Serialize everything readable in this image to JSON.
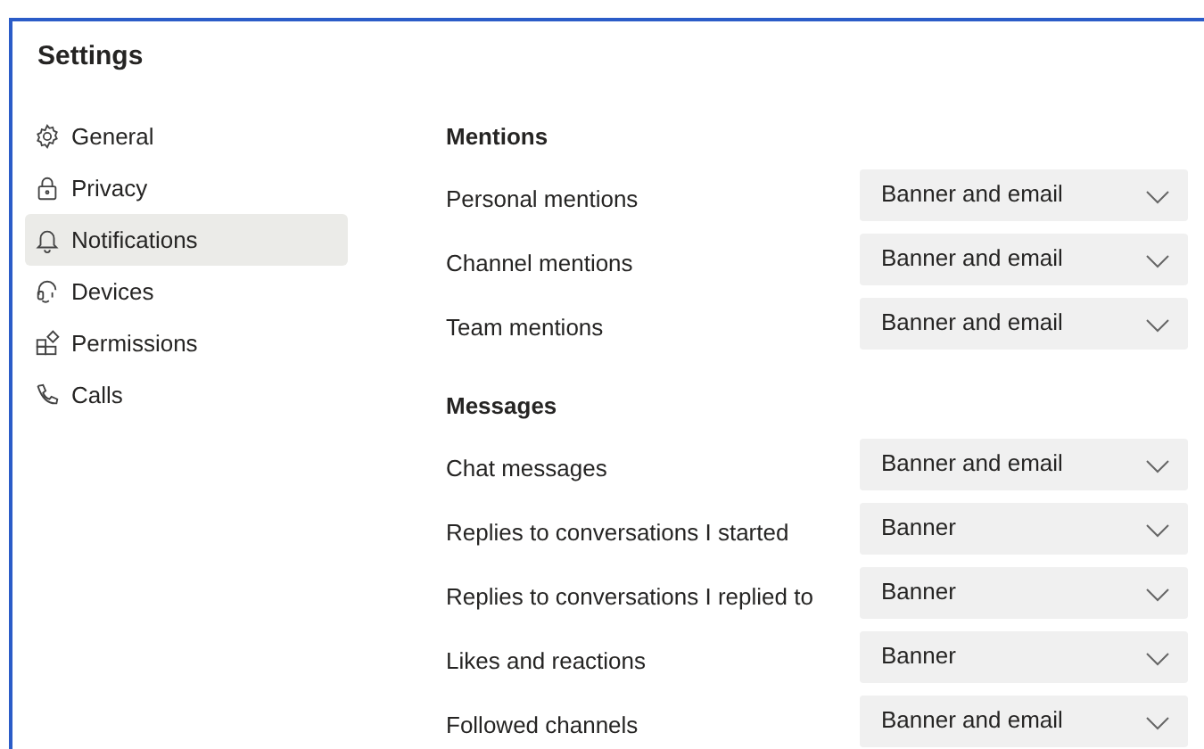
{
  "window": {
    "title": "Settings"
  },
  "sidebar": {
    "items": [
      {
        "label": "General",
        "selected": false
      },
      {
        "label": "Privacy",
        "selected": false
      },
      {
        "label": "Notifications",
        "selected": true
      },
      {
        "label": "Devices",
        "selected": false
      },
      {
        "label": "Permissions",
        "selected": false
      },
      {
        "label": "Calls",
        "selected": false
      }
    ]
  },
  "sections": [
    {
      "title": "Mentions",
      "rows": [
        {
          "label": "Personal mentions",
          "value": "Banner and email"
        },
        {
          "label": "Channel mentions",
          "value": "Banner and email"
        },
        {
          "label": "Team mentions",
          "value": "Banner and email"
        }
      ]
    },
    {
      "title": "Messages",
      "rows": [
        {
          "label": "Chat messages",
          "value": "Banner and email"
        },
        {
          "label": "Replies to conversations I started",
          "value": "Banner"
        },
        {
          "label": "Replies to conversations I replied to",
          "value": "Banner"
        },
        {
          "label": "Likes and reactions",
          "value": "Banner"
        },
        {
          "label": "Followed channels",
          "value": "Banner and email"
        }
      ]
    }
  ]
}
